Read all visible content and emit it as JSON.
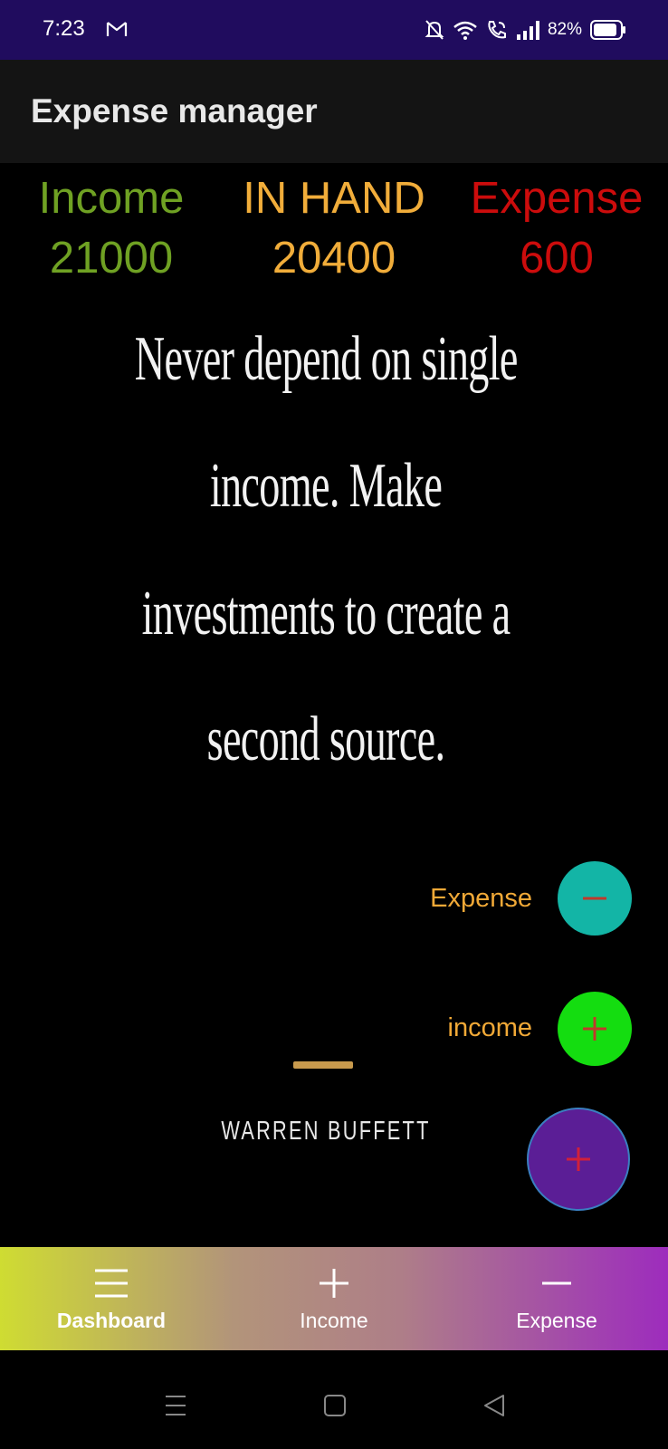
{
  "status_bar": {
    "time": "7:23",
    "battery": "82%",
    "icons": [
      "gmail-icon",
      "bell-off-icon",
      "wifi-icon",
      "wifi-call-icon",
      "signal-icon",
      "battery-icon"
    ]
  },
  "app_bar": {
    "title": "Expense manager"
  },
  "summary": {
    "income_label": "Income",
    "income_value": "21000",
    "inhand_label": "IN HAND",
    "inhand_value": "20400",
    "expense_label": "Expense",
    "expense_value": "600"
  },
  "quote": {
    "lines": [
      "Never depend on single",
      "income. Make",
      "investments to create a",
      "second source."
    ],
    "author": "WARREN BUFFETT"
  },
  "fab": {
    "expense_label": "Expense",
    "income_label": "income"
  },
  "bottom_nav": {
    "dashboard": "Dashboard",
    "income": "Income",
    "expense": "Expense"
  },
  "colors": {
    "income": "#6fa123",
    "in_hand": "#f1ad3a",
    "expense": "#cc0c0c",
    "status_bar": "#200c5e",
    "fab_expense": "#13b5a6",
    "fab_income": "#14dd10",
    "fab_main": "#5b1e96"
  }
}
